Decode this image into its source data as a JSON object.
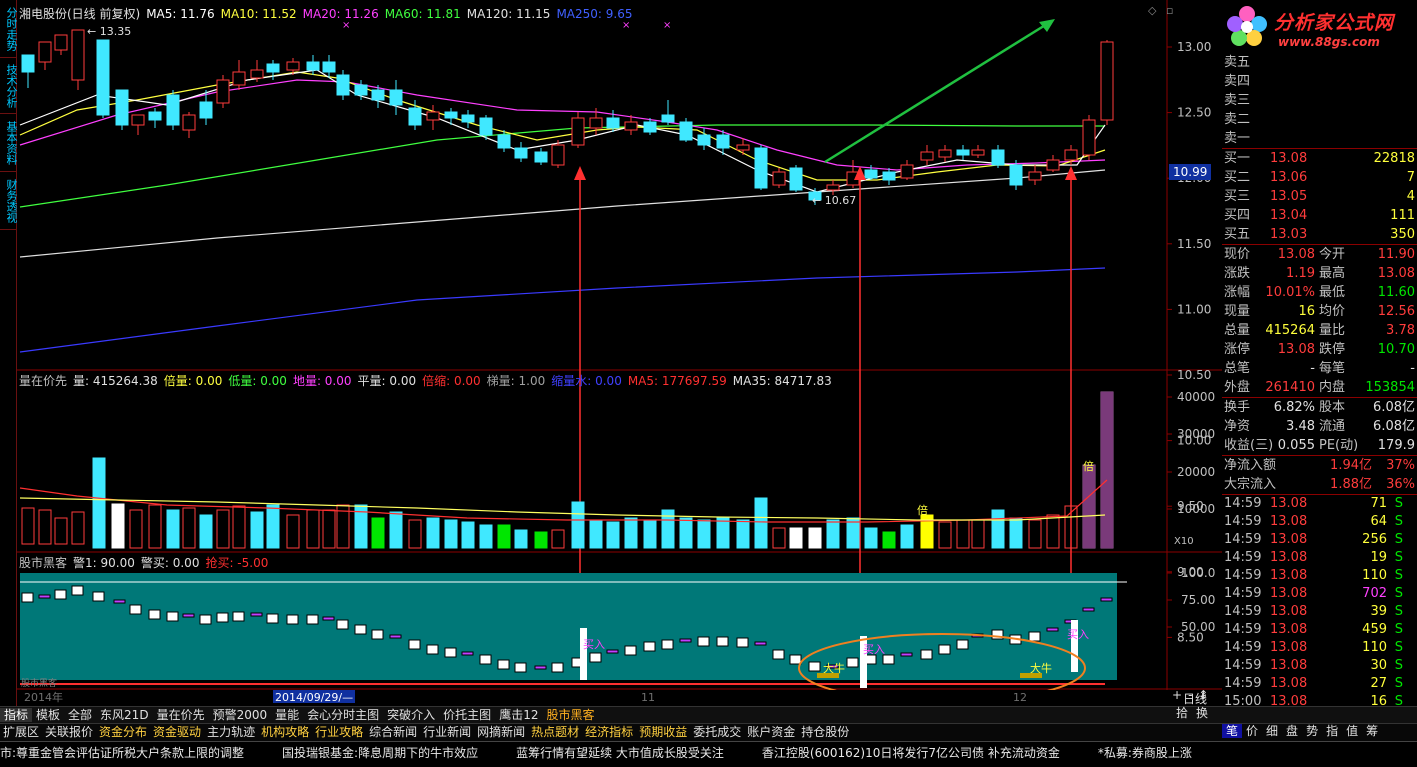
{
  "stock": {
    "name": "湘电股份(日线 前复权)",
    "ma_labels": [
      {
        "t": "MA5: 11.76",
        "c": "#ffffff"
      },
      {
        "t": "MA10: 11.52",
        "c": "#ffff40"
      },
      {
        "t": "MA20: 11.26",
        "c": "#ff40ff"
      },
      {
        "t": "MA60: 11.81",
        "c": "#40ff40"
      },
      {
        "t": "MA120: 11.15",
        "c": "#e0e0e0"
      },
      {
        "t": "MA250: 9.65",
        "c": "#4060ff"
      }
    ]
  },
  "lefttabs": [
    "分时走势",
    "技术分析",
    "基本资料",
    "财务透视"
  ],
  "vol_header": [
    {
      "t": "量在价先",
      "c": "#c0c0c0"
    },
    {
      "t": "量: 415264.38",
      "c": "#e0e0e0"
    },
    {
      "t": "倍量: 0.00",
      "c": "#ffff40"
    },
    {
      "t": "低量: 0.00",
      "c": "#40ff40"
    },
    {
      "t": "地量: 0.00",
      "c": "#ff40ff"
    },
    {
      "t": "平量: 0.00",
      "c": "#e0e0e0"
    },
    {
      "t": "倍缩: 0.00",
      "c": "#ff3030"
    },
    {
      "t": "梯量: 1.00",
      "c": "#a0a0a0"
    },
    {
      "t": "缩量水: 0.00",
      "c": "#4040ff"
    },
    {
      "t": "MA5: 177697.59",
      "c": "#ff3030"
    },
    {
      "t": "MA35: 84717.83",
      "c": "#e0e0e0"
    }
  ],
  "ind_header": [
    {
      "t": "股市黑客",
      "c": "#c0c0c0"
    },
    {
      "t": "警1: 90.00",
      "c": "#e0e0e0"
    },
    {
      "t": "警买: 0.00",
      "c": "#e0e0e0"
    },
    {
      "t": "抢买: -5.00",
      "c": "#ff3030"
    }
  ],
  "price_axis": [
    "13.00",
    "12.50",
    "12.00",
    "11.50",
    "11.00",
    "10.50",
    "10.00",
    "9.50",
    "9.00",
    "8.50"
  ],
  "vol_axis": [
    "40000",
    "30000",
    "20000",
    "10000"
  ],
  "vol_unit": "X10",
  "ind_axis": [
    "100.0",
    "75.00",
    "50.00"
  ],
  "current_price_tag": "10.99",
  "high_label": "13.35",
  "low_label": "10.67",
  "signal_labels": {
    "buy": "买入",
    "bull": "大牛",
    "double": "倍"
  },
  "date_axis": {
    "year": "2014年",
    "cursor": "2014/09/29/—",
    "m11": "11",
    "m12": "12"
  },
  "ind_footer": "股市黑客",
  "period": "日线",
  "zoom": [
    "+",
    "-",
    "↕"
  ],
  "logo": {
    "title": "分析家公式网",
    "url": "www.88gs.com"
  },
  "quote": {
    "sell": [
      {
        "l": "卖五"
      },
      {
        "l": "卖四"
      },
      {
        "l": "卖三"
      },
      {
        "l": "卖二"
      },
      {
        "l": "卖一"
      }
    ],
    "buy": [
      {
        "l": "买一",
        "p": "13.08",
        "v": "22818"
      },
      {
        "l": "买二",
        "p": "13.06",
        "v": "7"
      },
      {
        "l": "买三",
        "p": "13.05",
        "v": "4"
      },
      {
        "l": "买四",
        "p": "13.04",
        "v": "111"
      },
      {
        "l": "买五",
        "p": "13.03",
        "v": "350"
      }
    ],
    "stats": [
      {
        "l1": "现价",
        "v1": "13.08",
        "c1": "red",
        "l2": "今开",
        "v2": "11.90",
        "c2": "red"
      },
      {
        "l1": "涨跌",
        "v1": "1.19",
        "c1": "red",
        "l2": "最高",
        "v2": "13.08",
        "c2": "red"
      },
      {
        "l1": "涨幅",
        "v1": "10.01%",
        "c1": "red",
        "l2": "最低",
        "v2": "11.60",
        "c2": "grn"
      },
      {
        "l1": "现量",
        "v1": "16",
        "c1": "ylw",
        "l2": "均价",
        "v2": "12.56",
        "c2": "red"
      },
      {
        "l1": "总量",
        "v1": "415264",
        "c1": "ylw",
        "l2": "量比",
        "v2": "3.78",
        "c2": "red"
      },
      {
        "l1": "涨停",
        "v1": "13.08",
        "c1": "red",
        "l2": "跌停",
        "v2": "10.70",
        "c2": "grn"
      },
      {
        "l1": "总笔",
        "v1": "-",
        "c1": "wht",
        "l2": "每笔",
        "v2": "-",
        "c2": "wht"
      },
      {
        "l1": "外盘",
        "v1": "261410",
        "c1": "red",
        "l2": "内盘",
        "v2": "153854",
        "c2": "grn"
      }
    ],
    "stats2": [
      {
        "l1": "换手",
        "v1": "6.82%",
        "c1": "wht",
        "l2": "股本",
        "v2": "6.08亿",
        "c2": "wht"
      },
      {
        "l1": "净资",
        "v1": "3.48",
        "c1": "wht",
        "l2": "流通",
        "v2": "6.08亿",
        "c2": "wht"
      },
      {
        "l1": "收益(三)",
        "v1": "0.055",
        "c1": "wht",
        "l2": "PE(动)",
        "v2": "179.9",
        "c2": "wht"
      }
    ],
    "flow": [
      {
        "l1": "净流入额",
        "v1": "1.94亿",
        "c1": "red",
        "v2": "37%",
        "c2": "red"
      },
      {
        "l1": "大宗流入",
        "v1": "1.88亿",
        "c1": "red",
        "v2": "36%",
        "c2": "red"
      }
    ],
    "ticks": [
      {
        "t": "14:59",
        "p": "13.08",
        "v": "71",
        "c": "ylw",
        "s": "S"
      },
      {
        "t": "14:59",
        "p": "13.08",
        "v": "64",
        "c": "ylw",
        "s": "S"
      },
      {
        "t": "14:59",
        "p": "13.08",
        "v": "256",
        "c": "ylw",
        "s": "S"
      },
      {
        "t": "14:59",
        "p": "13.08",
        "v": "19",
        "c": "ylw",
        "s": "S"
      },
      {
        "t": "14:59",
        "p": "13.08",
        "v": "110",
        "c": "ylw",
        "s": "S"
      },
      {
        "t": "14:59",
        "p": "13.08",
        "v": "702",
        "c": "mag",
        "s": "S"
      },
      {
        "t": "14:59",
        "p": "13.08",
        "v": "39",
        "c": "ylw",
        "s": "S"
      },
      {
        "t": "14:59",
        "p": "13.08",
        "v": "459",
        "c": "ylw",
        "s": "S"
      },
      {
        "t": "14:59",
        "p": "13.08",
        "v": "110",
        "c": "ylw",
        "s": "S"
      },
      {
        "t": "14:59",
        "p": "13.08",
        "v": "30",
        "c": "ylw",
        "s": "S"
      },
      {
        "t": "14:59",
        "p": "13.08",
        "v": "27",
        "c": "ylw",
        "s": "S"
      },
      {
        "t": "15:00",
        "p": "13.08",
        "v": "16",
        "c": "ylw",
        "s": "S"
      }
    ]
  },
  "bottom_tabs": [
    {
      "t": "指标",
      "a": true
    },
    {
      "t": "模板"
    },
    {
      "t": "全部"
    },
    {
      "t": "东风21D"
    },
    {
      "t": "量在价先"
    },
    {
      "t": "预警2000"
    },
    {
      "t": "量能"
    },
    {
      "t": "会心分时主图"
    },
    {
      "t": "突破介入"
    },
    {
      "t": "价托主图"
    },
    {
      "t": "鹰击12"
    },
    {
      "t": "股市黑客",
      "hl": true
    }
  ],
  "sub_tabs": [
    {
      "t": "扩展区",
      "w": true
    },
    {
      "t": "关联报价",
      "w": true
    },
    {
      "t": "资金分布"
    },
    {
      "t": "资金驱动"
    },
    {
      "t": "主力轨迹",
      "w": true
    },
    {
      "t": "机构攻略"
    },
    {
      "t": "行业攻略"
    },
    {
      "t": "综合新闻",
      "w": true
    },
    {
      "t": "行业新闻",
      "w": true
    },
    {
      "t": "网摘新闻",
      "w": true
    },
    {
      "t": "热点题材"
    },
    {
      "t": "经济指标"
    },
    {
      "t": "预期收益"
    },
    {
      "t": "委托成交",
      "w": true
    },
    {
      "t": "账户资金",
      "w": true
    },
    {
      "t": "持仓股份",
      "w": true
    }
  ],
  "right_tabs": [
    "拾",
    "换"
  ],
  "right_bottom_tabs": [
    {
      "t": "笔",
      "a": true
    },
    {
      "t": "价"
    },
    {
      "t": "细"
    },
    {
      "t": "盘"
    },
    {
      "t": "势"
    },
    {
      "t": "指"
    },
    {
      "t": "值"
    },
    {
      "t": "筹"
    }
  ],
  "ticker": [
    "市:尊重金管会评估证所税大户条款上限的调整",
    "国投瑞银基金:降息周期下的牛市效应",
    "蓝筹行情有望延续 大市值成长股受关注",
    "香江控股(600162)10日将发行7亿公司债 补充流动资金",
    "*私募:券商股上涨"
  ]
}
